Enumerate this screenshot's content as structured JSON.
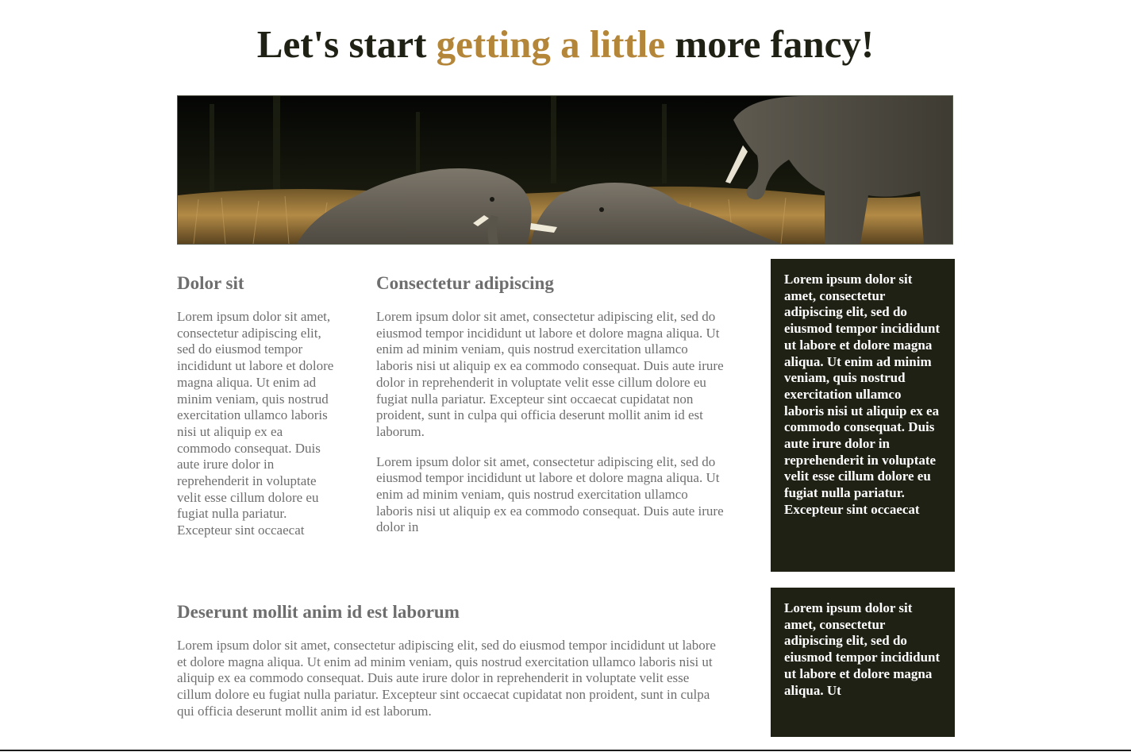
{
  "header": {
    "title_part1": "Let's start ",
    "title_accent": "getting a little",
    "title_part2": " more fancy!",
    "accent_color": "#b4863a",
    "text_color": "#1f2114"
  },
  "hero": {
    "subject": "elephants in grassland"
  },
  "left_column": {
    "heading": "Dolor sit",
    "text": "Lorem ipsum dolor sit amet, consectetur adipiscing elit, sed do eiusmod tempor incididunt ut labore et dolore magna aliqua. Ut enim ad minim veniam, quis nostrud exercitation ullamco laboris nisi ut aliquip ex ea commodo consequat. Duis aute irure dolor in reprehenderit in voluptate velit esse cillum dolore eu fugiat nulla pariatur. Excepteur sint occaecat"
  },
  "middle_column": {
    "heading": "Consectetur adipiscing",
    "paragraph1": "Lorem ipsum dolor sit amet, consectetur adipiscing elit, sed do eiusmod tempor incididunt ut labore et dolore magna aliqua. Ut enim ad minim veniam, quis nostrud exercitation ullamco laboris nisi ut aliquip ex ea commodo consequat. Duis aute irure dolor in reprehenderit in voluptate velit esse cillum dolore eu fugiat nulla pariatur. Excepteur sint occaecat cupidatat non proident, sunt in culpa qui officia deserunt mollit anim id est laborum.",
    "paragraph2": "Lorem ipsum dolor sit amet, consectetur adipiscing elit, sed do eiusmod tempor incididunt ut labore et dolore magna aliqua. Ut enim ad minim veniam, quis nostrud exercitation ullamco laboris nisi ut aliquip ex ea commodo consequat. Duis aute irure dolor in"
  },
  "bottom_section": {
    "heading": "Deserunt mollit anim id est laborum",
    "text": "Lorem ipsum dolor sit amet, consectetur adipiscing elit, sed do eiusmod tempor incididunt ut labore et dolore magna aliqua. Ut enim ad minim veniam, quis nostrud exercitation ullamco laboris nisi ut aliquip ex ea commodo consequat. Duis aute irure dolor in reprehenderit in voluptate velit esse cillum dolore eu fugiat nulla pariatur. Excepteur sint occaecat cupidatat non proident, sunt in culpa qui officia deserunt mollit anim id est laborum."
  },
  "sidebar": {
    "box1_text": "Lorem ipsum dolor sit amet, consectetur adipiscing elit, sed do eiusmod tempor incididunt ut labore et dolore magna aliqua. Ut enim ad minim veniam, quis nostrud exercitation ullamco laboris nisi ut aliquip ex ea commodo consequat. Duis aute irure dolor in reprehenderit in voluptate velit esse cillum dolore eu fugiat nulla pariatur. Excepteur sint occaecat",
    "box2_text": "Lorem ipsum dolor sit amet, consectetur adipiscing elit, sed do eiusmod tempor incididunt ut labore et dolore magna aliqua. Ut",
    "box_color": "#1f2114"
  }
}
